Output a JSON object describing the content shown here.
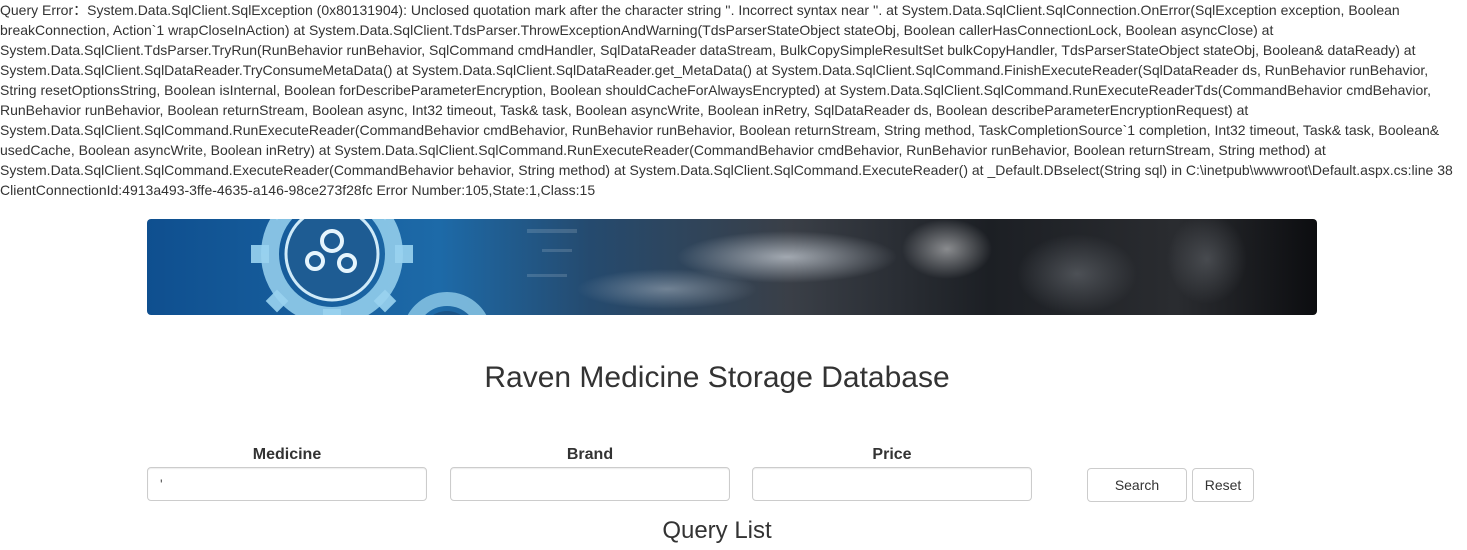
{
  "error": {
    "message": "Query Error：System.Data.SqlClient.SqlException (0x80131904): Unclosed quotation mark after the character string ''. Incorrect syntax near ''. at System.Data.SqlClient.SqlConnection.OnError(SqlException exception, Boolean breakConnection, Action`1 wrapCloseInAction) at System.Data.SqlClient.TdsParser.ThrowExceptionAndWarning(TdsParserStateObject stateObj, Boolean callerHasConnectionLock, Boolean asyncClose) at System.Data.SqlClient.TdsParser.TryRun(RunBehavior runBehavior, SqlCommand cmdHandler, SqlDataReader dataStream, BulkCopySimpleResultSet bulkCopyHandler, TdsParserStateObject stateObj, Boolean& dataReady) at System.Data.SqlClient.SqlDataReader.TryConsumeMetaData() at System.Data.SqlClient.SqlDataReader.get_MetaData() at System.Data.SqlClient.SqlCommand.FinishExecuteReader(SqlDataReader ds, RunBehavior runBehavior, String resetOptionsString, Boolean isInternal, Boolean forDescribeParameterEncryption, Boolean shouldCacheForAlwaysEncrypted) at System.Data.SqlClient.SqlCommand.RunExecuteReaderTds(CommandBehavior cmdBehavior, RunBehavior runBehavior, Boolean returnStream, Boolean async, Int32 timeout, Task& task, Boolean asyncWrite, Boolean inRetry, SqlDataReader ds, Boolean describeParameterEncryptionRequest) at System.Data.SqlClient.SqlCommand.RunExecuteReader(CommandBehavior cmdBehavior, RunBehavior runBehavior, Boolean returnStream, String method, TaskCompletionSource`1 completion, Int32 timeout, Task& task, Boolean& usedCache, Boolean asyncWrite, Boolean inRetry) at System.Data.SqlClient.SqlCommand.RunExecuteReader(CommandBehavior cmdBehavior, RunBehavior runBehavior, Boolean returnStream, String method) at System.Data.SqlClient.SqlCommand.ExecuteReader(CommandBehavior behavior, String method) at System.Data.SqlClient.SqlCommand.ExecuteReader() at _Default.DBselect(String sql) in C:\\inetpub\\wwwroot\\Default.aspx.cs:line 38 ClientConnectionId:4913a493-3ffe-4635-a146-98ce273f28fc Error Number:105,State:1,Class:15"
  },
  "banner": {
    "icon": "gear-icon"
  },
  "page": {
    "title": "Raven Medicine Storage Database"
  },
  "search": {
    "medicine_label": "Medicine",
    "medicine_value": "'",
    "brand_label": "Brand",
    "brand_value": "",
    "price_label": "Price",
    "price_value": "",
    "search_button": "Search",
    "reset_button": "Reset"
  },
  "results": {
    "title": "Query List"
  },
  "colors": {
    "text": "#333333",
    "input_border": "#cccccc",
    "banner_blue": "#1a5fa0"
  }
}
